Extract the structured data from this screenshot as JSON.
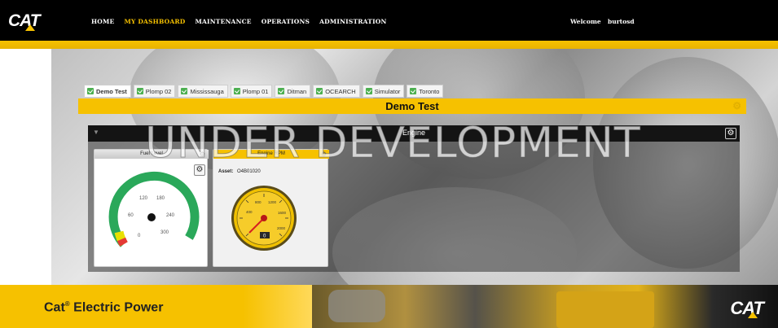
{
  "header": {
    "logo_text": "CAT",
    "nav": [
      {
        "label": "HOME",
        "active": false
      },
      {
        "label": "MY DASHBOARD",
        "active": true
      },
      {
        "label": "MAINTENANCE",
        "active": false
      },
      {
        "label": "OPERATIONS",
        "active": false
      },
      {
        "label": "ADMINISTRATION",
        "active": false
      }
    ],
    "welcome_label": "Welcome",
    "username": "burtosd"
  },
  "tabs": [
    {
      "label": "Demo Test",
      "active": true
    },
    {
      "label": "Plomp 02",
      "active": false
    },
    {
      "label": "Mississauga",
      "active": false
    },
    {
      "label": "Plomp 01",
      "active": false
    },
    {
      "label": "Ditman",
      "active": false
    },
    {
      "label": "OCEARCH",
      "active": false
    },
    {
      "label": "Simulator",
      "active": false
    },
    {
      "label": "Toronto",
      "active": false
    }
  ],
  "dashboard": {
    "title": "Demo Test",
    "watermark": "UNDER DEVELOPMENT",
    "panel_title": "Engine"
  },
  "widgets": {
    "fuel": {
      "title": "Fuel Level",
      "gauge_ticks": [
        "0",
        "60",
        "120",
        "180",
        "240",
        "300"
      ],
      "needle_value": 0
    },
    "rpm": {
      "title": "Engine RPM",
      "asset_label": "Asset:",
      "asset_value": "O4B01020",
      "gauge_ticks": [
        "400",
        "800",
        "1200",
        "1600",
        "2000"
      ],
      "digital_value": "0",
      "needle_value": 0
    }
  },
  "footer": {
    "brand_text": "Cat",
    "brand_suffix": "Electric Power",
    "logo_text": "CAT"
  },
  "colors": {
    "accent": "#f6c100",
    "nav_active": "#f6c100",
    "gauge_green": "#2aa85a",
    "gauge_yellow": "#e8e000",
    "gauge_red": "#e53935"
  }
}
